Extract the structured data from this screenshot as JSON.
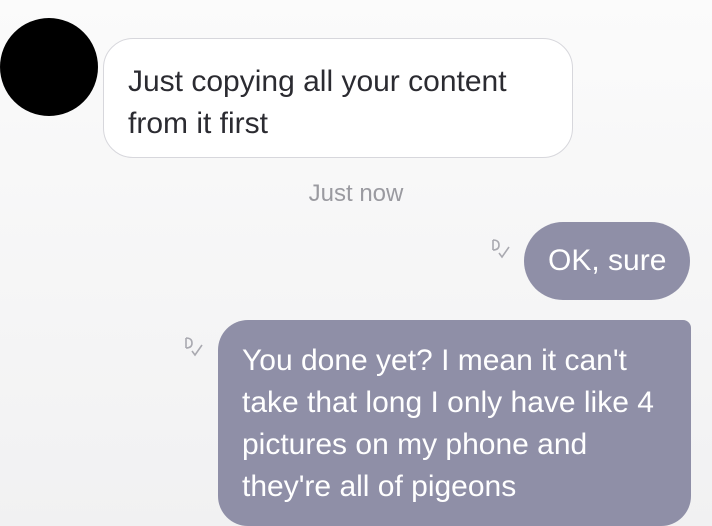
{
  "conversation": {
    "incoming": {
      "avatar": "contact-avatar",
      "message": "Just copying all your content from it first"
    },
    "timestamp": "Just now",
    "outgoing": [
      {
        "message": "OK, sure",
        "status_icon": "delivered-icon"
      },
      {
        "message": "You done yet? I mean it can't take that long I only have like 4 pictures on my phone and they're all of pigeons",
        "status_icon": "delivered-icon"
      }
    ]
  },
  "colors": {
    "outgoing_bubble": "#8f8fa7",
    "incoming_bubble": "#ffffff",
    "incoming_text": "#2b2b31",
    "timestamp_text": "#9a9aa0"
  }
}
